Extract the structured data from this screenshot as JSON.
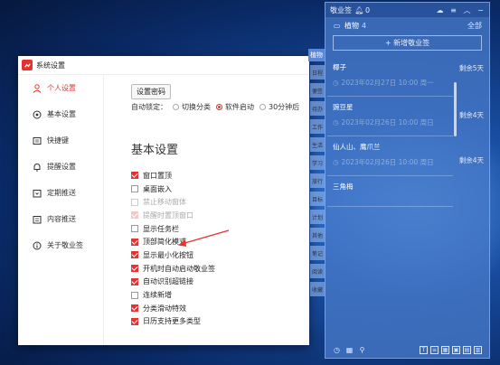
{
  "settings": {
    "title": "系统设置",
    "nav": [
      {
        "label": "个人设置",
        "icon": "person-icon",
        "active": true
      },
      {
        "label": "基本设置",
        "icon": "settings-icon",
        "active": false
      },
      {
        "label": "快捷键",
        "icon": "keyboard-icon",
        "active": false
      },
      {
        "label": "提醒设置",
        "icon": "bell-icon",
        "active": false
      },
      {
        "label": "定期推送",
        "icon": "calendar-icon",
        "active": false
      },
      {
        "label": "内容推送",
        "icon": "content-icon",
        "active": false
      },
      {
        "label": "关于敬业签",
        "icon": "info-icon",
        "active": false
      }
    ],
    "set_password_label": "设置密码",
    "auto_lock_label": "自动锁定：",
    "lock_options": [
      "切换分类",
      "软件启动",
      "30分钟后"
    ],
    "lock_selected": "软件启动",
    "section_title": "基本设置",
    "checks": [
      {
        "label": "窗口置顶",
        "state": "checked"
      },
      {
        "label": "桌面嵌入",
        "state": "unchecked"
      },
      {
        "label": "禁止移动窗体",
        "state": "disabled"
      },
      {
        "label": "提醒时置顶窗口",
        "state": "disabled-checked"
      },
      {
        "label": "显示任务栏",
        "state": "unchecked"
      },
      {
        "label": "顶部简化模式",
        "state": "checked"
      },
      {
        "label": "显示最小化按钮",
        "state": "checked"
      },
      {
        "label": "开机时自动启动敬业签",
        "state": "checked"
      },
      {
        "label": "自动识别超链接",
        "state": "checked"
      },
      {
        "label": "连续新增",
        "state": "unchecked"
      },
      {
        "label": "分类滑动特效",
        "state": "checked"
      },
      {
        "label": "日历支持更多类型",
        "state": "checked"
      }
    ]
  },
  "note": {
    "app_name": "敬业签",
    "count": "0",
    "category": "植物",
    "category_count": "4",
    "filter": "全部",
    "add_label": "+ 新增敬业签",
    "items": [
      {
        "title": "椰子",
        "date": "2023年02月27日 10:00 周一",
        "peek": "剩余5天"
      },
      {
        "title": "豌豆星",
        "date": "2023年02月26日 10:00 周日",
        "peek": "剩余4天"
      },
      {
        "title": "仙人山、鹰爪兰",
        "date": "2023年02月26日 10:00 周日",
        "peek": "剩余4天"
      },
      {
        "title": "三角梅",
        "date": "",
        "peek": ""
      }
    ]
  },
  "tabs": {
    "header": "植物",
    "labels": [
      "日程",
      "便签",
      "待办",
      "工作",
      "生活",
      "学习",
      "旅行",
      "目标",
      "计划",
      "其他",
      "笔记",
      "阅读",
      "收藏"
    ]
  }
}
